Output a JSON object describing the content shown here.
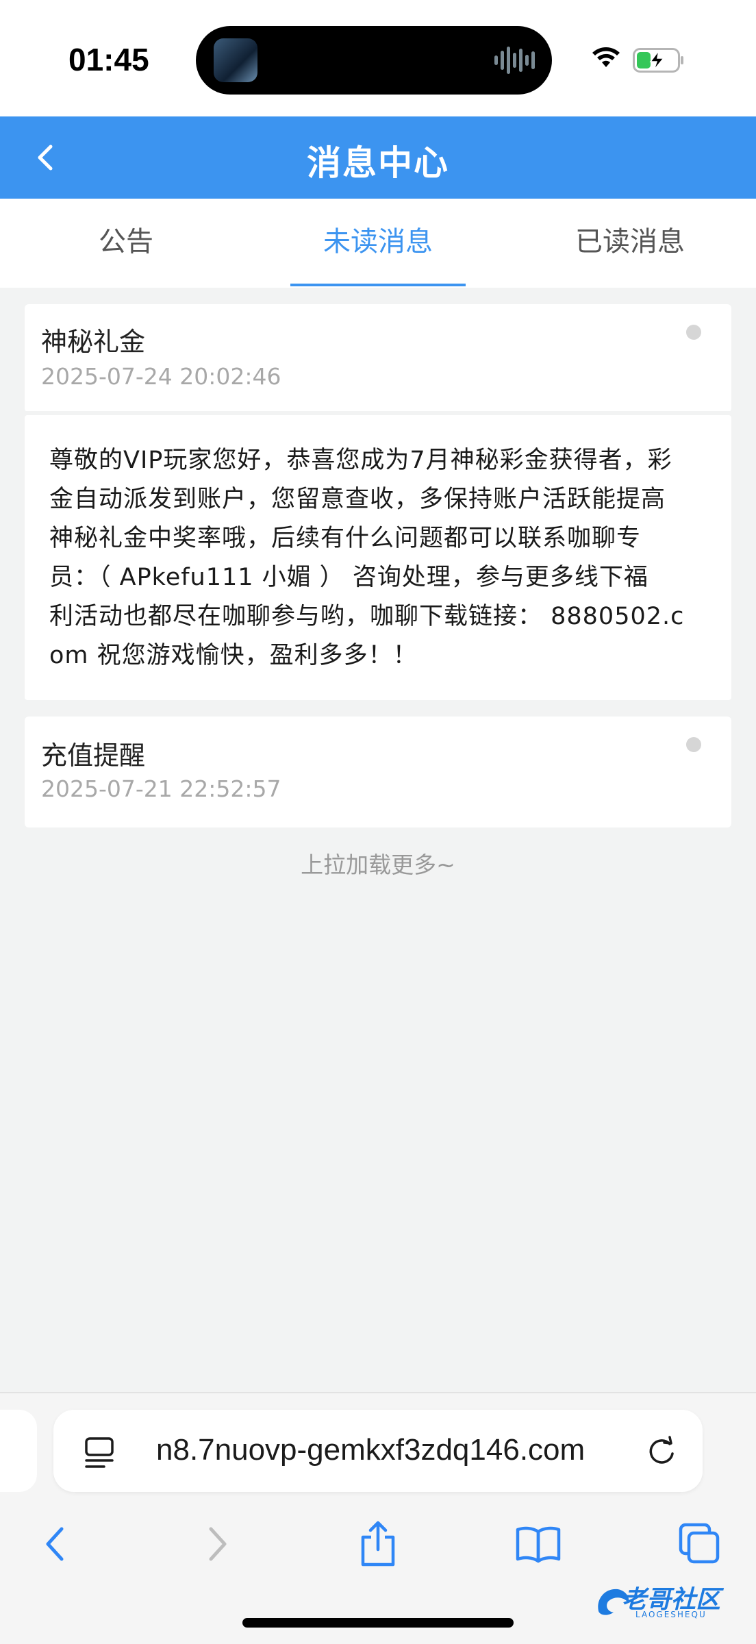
{
  "status_bar": {
    "time": "01:45"
  },
  "header": {
    "title": "消息中心"
  },
  "tabs": [
    {
      "label": "公告",
      "active": false
    },
    {
      "label": "未读消息",
      "active": true
    },
    {
      "label": "已读消息",
      "active": false
    }
  ],
  "messages": [
    {
      "title": "神秘礼金",
      "date": "2025-07-24 20:02:46",
      "body_lines": [
        "尊敬的VIP玩家您好，恭喜您成为7月神秘彩金获得者，彩",
        "金自动派发到账户，您留意查收，多保持账户活跃能提高",
        "神秘礼金中奖率哦，后续有什么问题都可以联系咖聊专",
        "员：（ APkefu111  小媚 ） 咨询处理，参与更多线下福",
        "利活动也都尽在咖聊参与哟，咖聊下载链接： 8880502.c",
        "om 祝您游戏愉快，盈利多多！！"
      ]
    },
    {
      "title": "充值提醒",
      "date": "2025-07-21 22:52:57"
    }
  ],
  "load_more": "上拉加载更多~",
  "browser": {
    "url": "n8.7nuovp-gemkxf3zdq146.com"
  },
  "watermark": {
    "text": "老哥社区",
    "sub": "LAOGESHEQU"
  },
  "colors": {
    "accent": "#3c94f0",
    "background": "#f2f3f3"
  }
}
